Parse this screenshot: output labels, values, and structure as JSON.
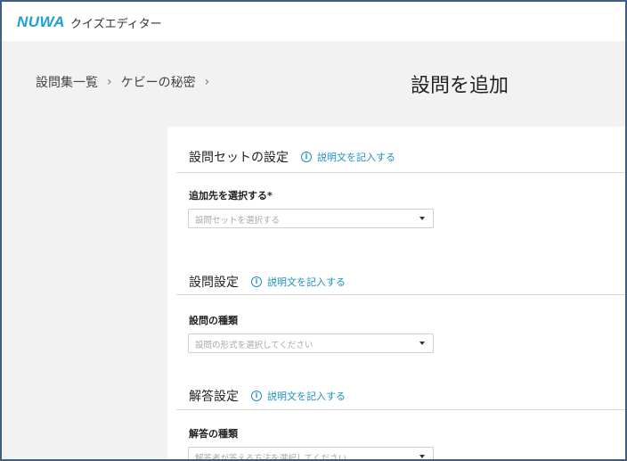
{
  "header": {
    "logo": "NUWA",
    "app_name": "クイズエディター"
  },
  "breadcrumb": {
    "items": [
      "設問集一覧",
      "ケビーの秘密"
    ],
    "separator": "›"
  },
  "page_title": "設問を追加",
  "sections": {
    "set_settings": {
      "title": "設問セットの設定",
      "help_link": "説明文を記入する",
      "field_label": "追加先を選択する*",
      "placeholder": "設問セットを選択する"
    },
    "question_settings": {
      "title": "設問設定",
      "help_link": "説明文を記入する",
      "field_label": "設問の種類",
      "placeholder": "設問の形式を選択してください"
    },
    "answer_settings": {
      "title": "解答設定",
      "help_link": "説明文を記入する",
      "field_label": "解答の種類",
      "placeholder": "解答者が答える方法を選択してください"
    }
  },
  "colors": {
    "brand": "#1d9fd0",
    "link": "#1d8fc0",
    "background": "#f2f2f2"
  },
  "icons": {
    "help": "info-circle-icon",
    "dropdown": "caret-down-icon",
    "breadcrumb_separator": "chevron-right-icon"
  }
}
